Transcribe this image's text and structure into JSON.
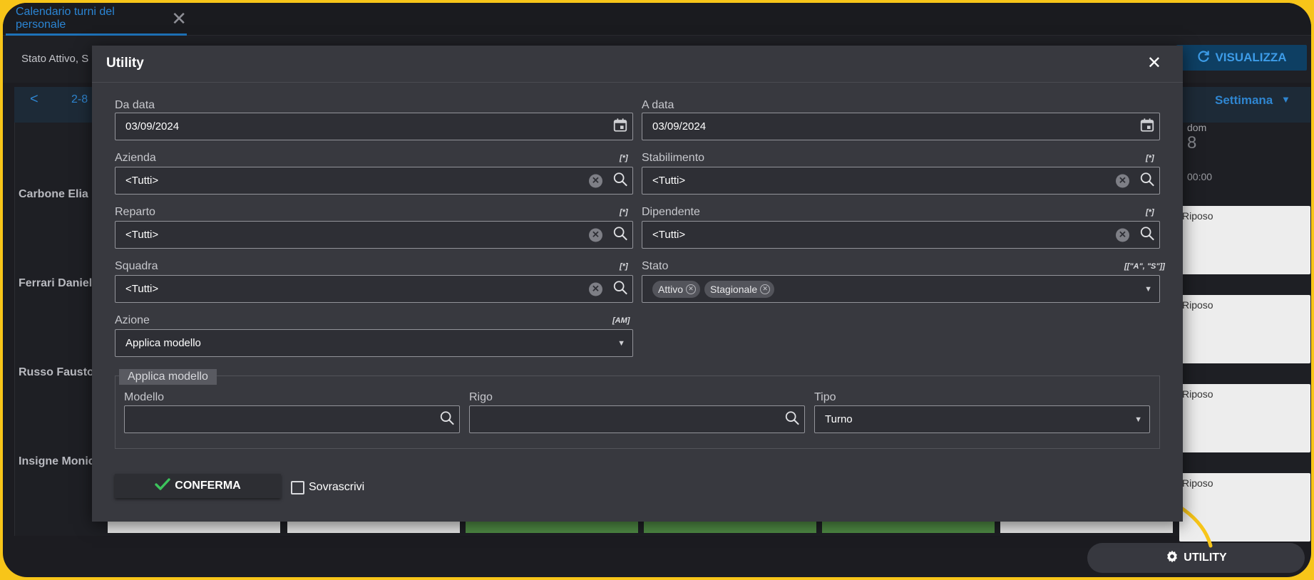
{
  "app": {
    "tab_label": "Calendario turni del personale",
    "tab_close": "✕",
    "stato_filter": "Stato Attivo, S",
    "visualizza_label": "VISUALIZZA",
    "range_label": "2-8",
    "view_mode": "Settimana",
    "prev_glyph": "<",
    "day_name": "dom",
    "day_number": "8",
    "day_time": "00:00",
    "employees": [
      "Carbone Elia",
      "Ferrari Daniele",
      "Russo Fausto",
      "Insigne Monic"
    ],
    "riposo_label": "Riposo",
    "utility_button": "UTILITY"
  },
  "modal": {
    "title": "Utility",
    "close": "✕",
    "da_data": {
      "label": "Da data",
      "value": "03/09/2024"
    },
    "a_data": {
      "label": "A data",
      "value": "03/09/2024"
    },
    "azienda": {
      "label": "Azienda",
      "hint": "[*]",
      "value": "<Tutti>"
    },
    "stabilimento": {
      "label": "Stabilimento",
      "hint": "[*]",
      "value": "<Tutti>"
    },
    "reparto": {
      "label": "Reparto",
      "hint": "[*]",
      "value": "<Tutti>"
    },
    "dipendente": {
      "label": "Dipendente",
      "hint": "[*]",
      "value": "<Tutti>"
    },
    "squadra": {
      "label": "Squadra",
      "hint": "[*]",
      "value": "<Tutti>"
    },
    "stato": {
      "label": "Stato",
      "hint": "[[\"A\", \"S\"]]",
      "chips": [
        "Attivo",
        "Stagionale"
      ]
    },
    "azione": {
      "label": "Azione",
      "hint": "[AM]",
      "value": "Applica modello"
    },
    "group": {
      "legend": "Applica modello",
      "modello": {
        "label": "Modello",
        "value": ""
      },
      "rigo": {
        "label": "Rigo",
        "value": ""
      },
      "tipo": {
        "label": "Tipo",
        "value": "Turno"
      }
    },
    "confirm_label": "CONFERMA",
    "sovrascrivi_label": "Sovrascrivi"
  },
  "colors": {
    "accent": "#2b85d4",
    "highlight": "#f7c519",
    "success": "#3cc45c"
  }
}
